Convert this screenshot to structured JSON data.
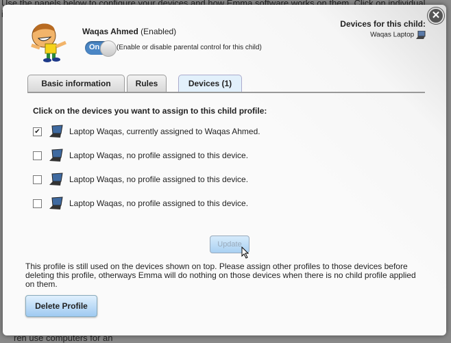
{
  "background": {
    "top_text": "Use the panels below to configure your devices and how Emma software works on them. Click on individual items to see more",
    "bottom_text": "ren use computers for an"
  },
  "child": {
    "name": "Waqas Ahmed",
    "status": "(Enabled)",
    "toggle_label": "On",
    "toggle_hint": "(Enable or disable parental control for this child)"
  },
  "devices_for_child": {
    "title": "Devices for this child:",
    "device": "Waqas Laptop"
  },
  "tabs": [
    {
      "label": "Basic information"
    },
    {
      "label": "Rules"
    },
    {
      "label": "Devices (1)",
      "active": true
    }
  ],
  "devices_panel": {
    "intro": "Click on the devices you want to assign to this child profile:",
    "devices": [
      {
        "label": "Laptop Waqas, currently assigned to Waqas Ahmed.",
        "checked": true
      },
      {
        "label": "Laptop Waqas, no profile assigned to this device.",
        "checked": false
      },
      {
        "label": "Laptop Waqas, no profile assigned to this device.",
        "checked": false
      },
      {
        "label": "Laptop Waqas, no profile assigned to this device.",
        "checked": false
      }
    ],
    "update_label": "Update"
  },
  "warning": "This profile is still used on the devices shown on top. Please assign other profiles to those devices before deleting this profile, otherways Emma will do nothing on those devices when there is no child profile applied on them.",
  "delete_label": "Delete Profile",
  "colors": {
    "accent": "#4a86c5",
    "button": "#a9d0f2"
  }
}
